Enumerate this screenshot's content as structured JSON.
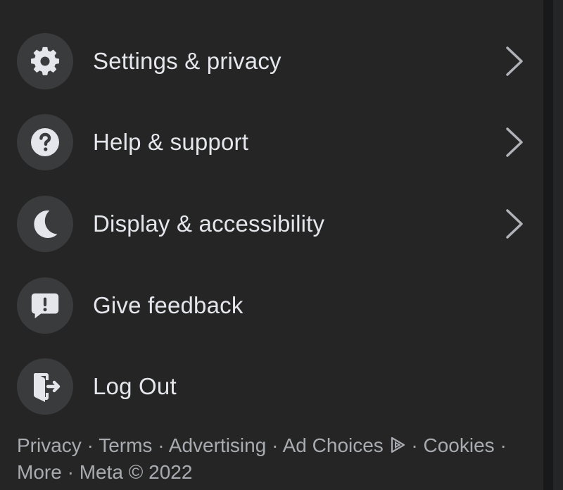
{
  "menu": {
    "items": [
      {
        "label": "Settings & privacy",
        "icon": "gear-icon",
        "has_chevron": true
      },
      {
        "label": "Help & support",
        "icon": "question-icon",
        "has_chevron": true
      },
      {
        "label": "Display & accessibility",
        "icon": "moon-icon",
        "has_chevron": true
      },
      {
        "label": "Give feedback",
        "icon": "feedback-icon",
        "has_chevron": false
      },
      {
        "label": "Log Out",
        "icon": "logout-icon",
        "has_chevron": false
      }
    ]
  },
  "footer": {
    "privacy": "Privacy",
    "terms": "Terms",
    "advertising": "Advertising",
    "ad_choices": "Ad Choices",
    "cookies": "Cookies",
    "more": "More",
    "meta": "Meta © 2022",
    "separator": "·"
  },
  "colors": {
    "background": "#252526",
    "icon_circle": "#3a3b3c",
    "text": "#e4e6eb",
    "muted_text": "#a8abaf",
    "chevron": "#b0b3b8"
  }
}
